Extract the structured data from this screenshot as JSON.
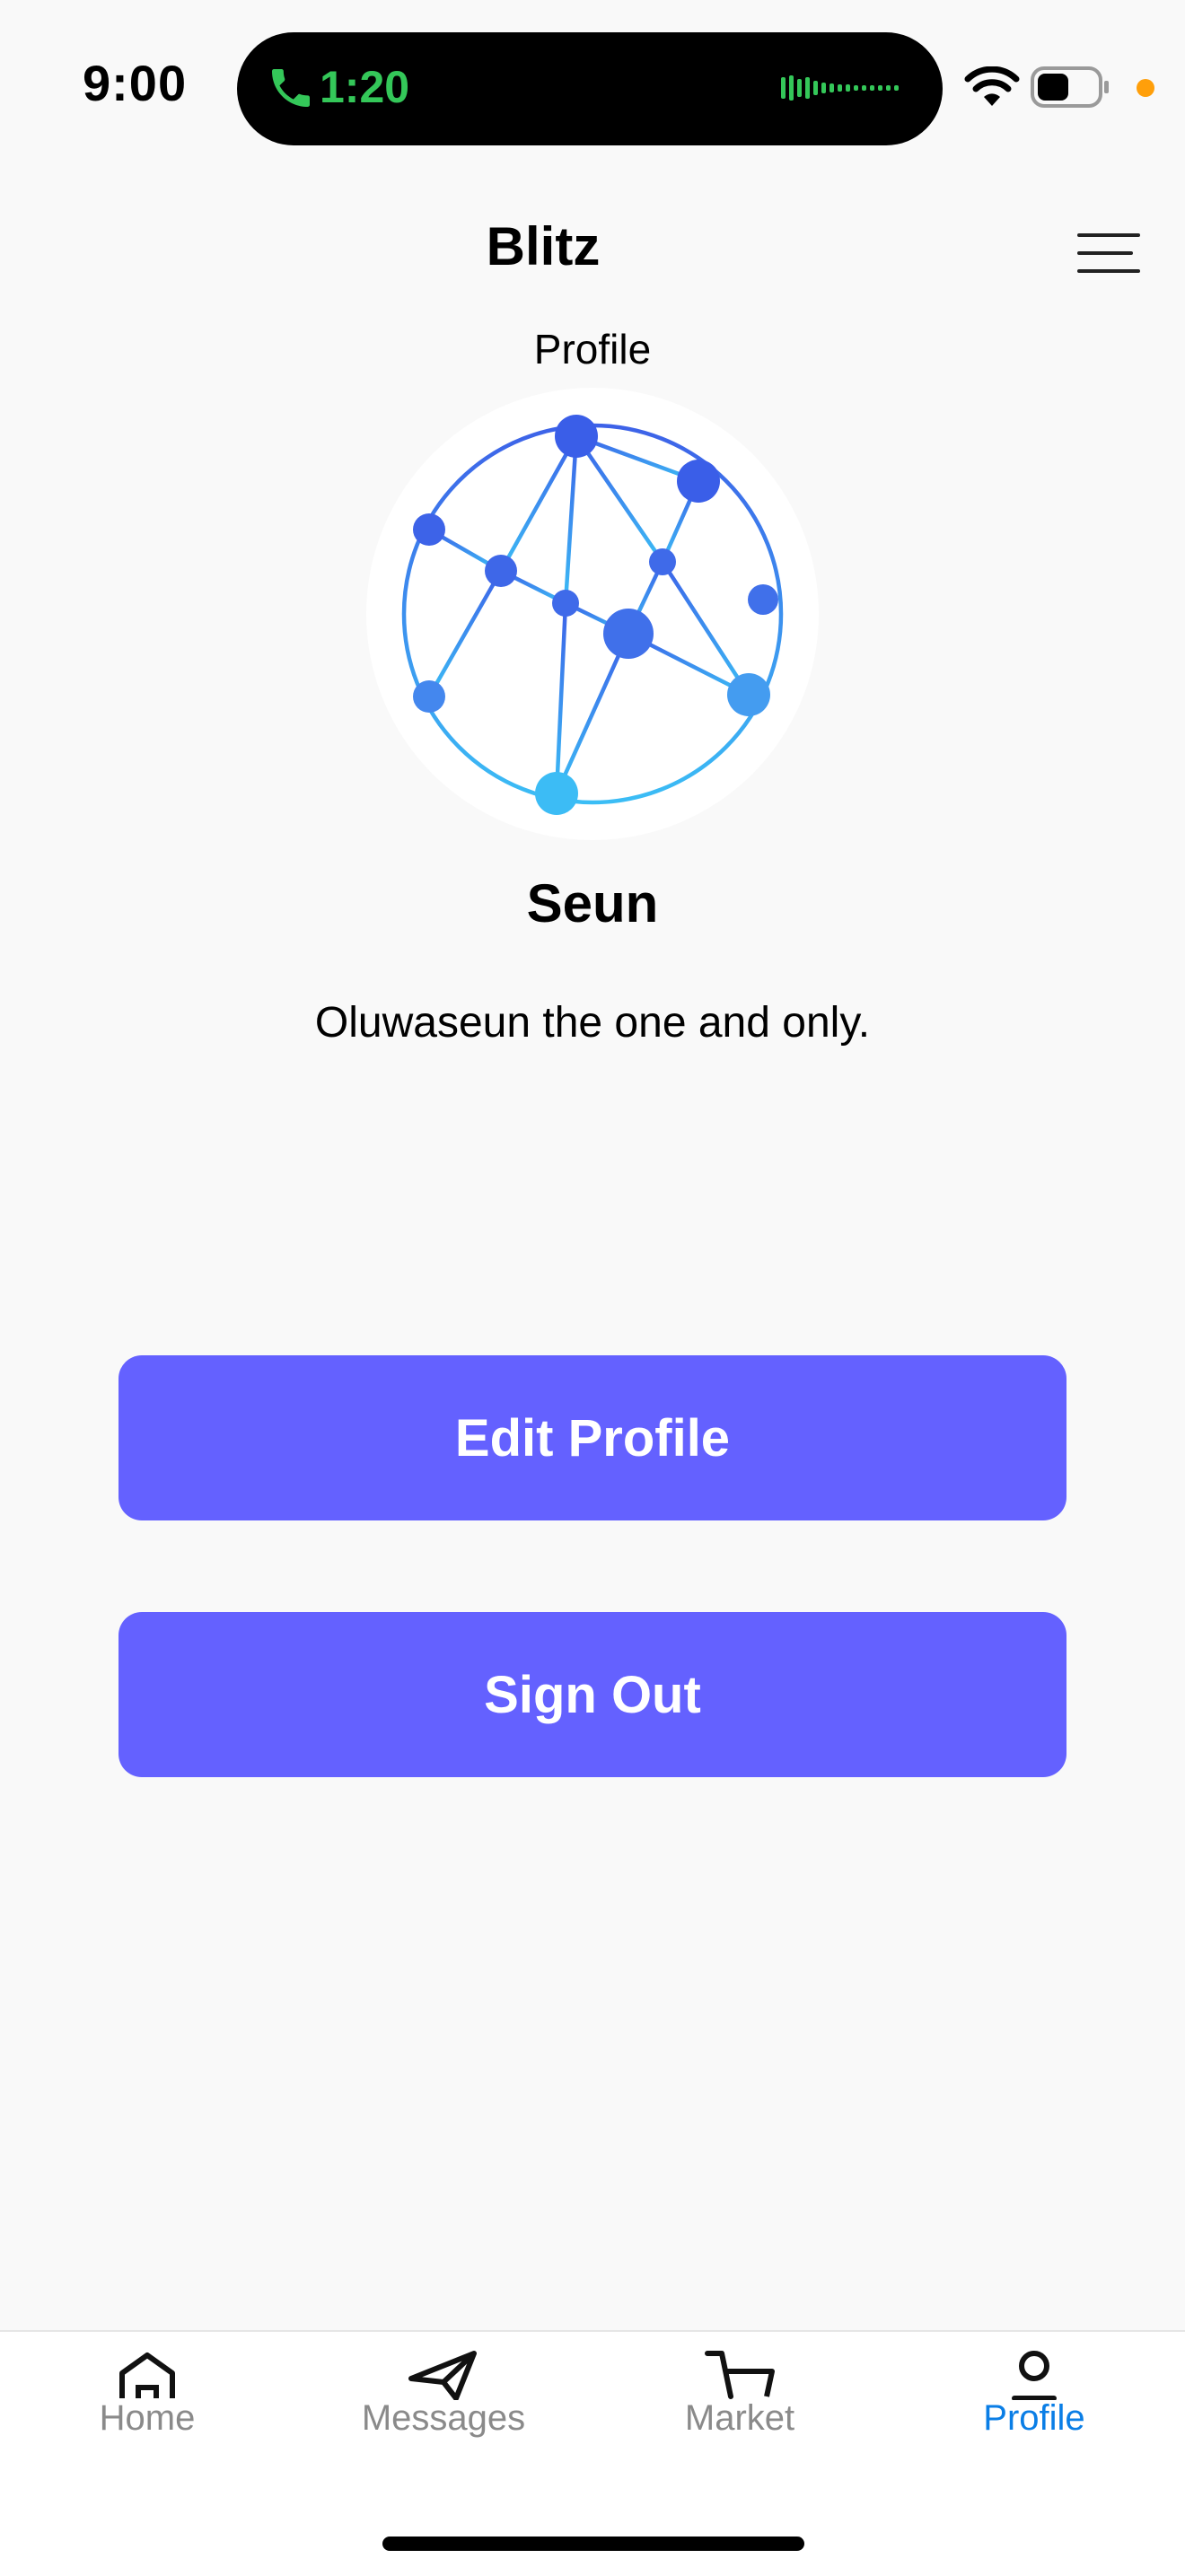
{
  "status_bar": {
    "time": "9:00",
    "call_timer": "1:20",
    "icons": [
      "phone-icon",
      "waveform-icon",
      "wifi-icon",
      "battery-icon"
    ],
    "call_color": "#34c759",
    "privacy_dot_color": "#ff9f0a"
  },
  "header": {
    "app_title": "Blitz",
    "subtitle": "Profile",
    "menu_icon": "hamburger-menu-icon"
  },
  "profile": {
    "avatar_icon": "network-globe-avatar",
    "name": "Seun",
    "bio": "Oluwaseun the one and only."
  },
  "actions": {
    "edit_label": "Edit Profile",
    "signout_label": "Sign Out",
    "button_color": "#6461ff"
  },
  "tab_bar": {
    "tabs": [
      {
        "label": "Home",
        "icon": "home-icon",
        "active": false
      },
      {
        "label": "Messages",
        "icon": "paper-plane-icon",
        "active": false
      },
      {
        "label": "Market",
        "icon": "cart-icon",
        "active": false
      },
      {
        "label": "Profile",
        "icon": "person-icon",
        "active": true
      }
    ],
    "active_color": "#0a7ee6",
    "inactive_color": "#8a8a8a"
  }
}
